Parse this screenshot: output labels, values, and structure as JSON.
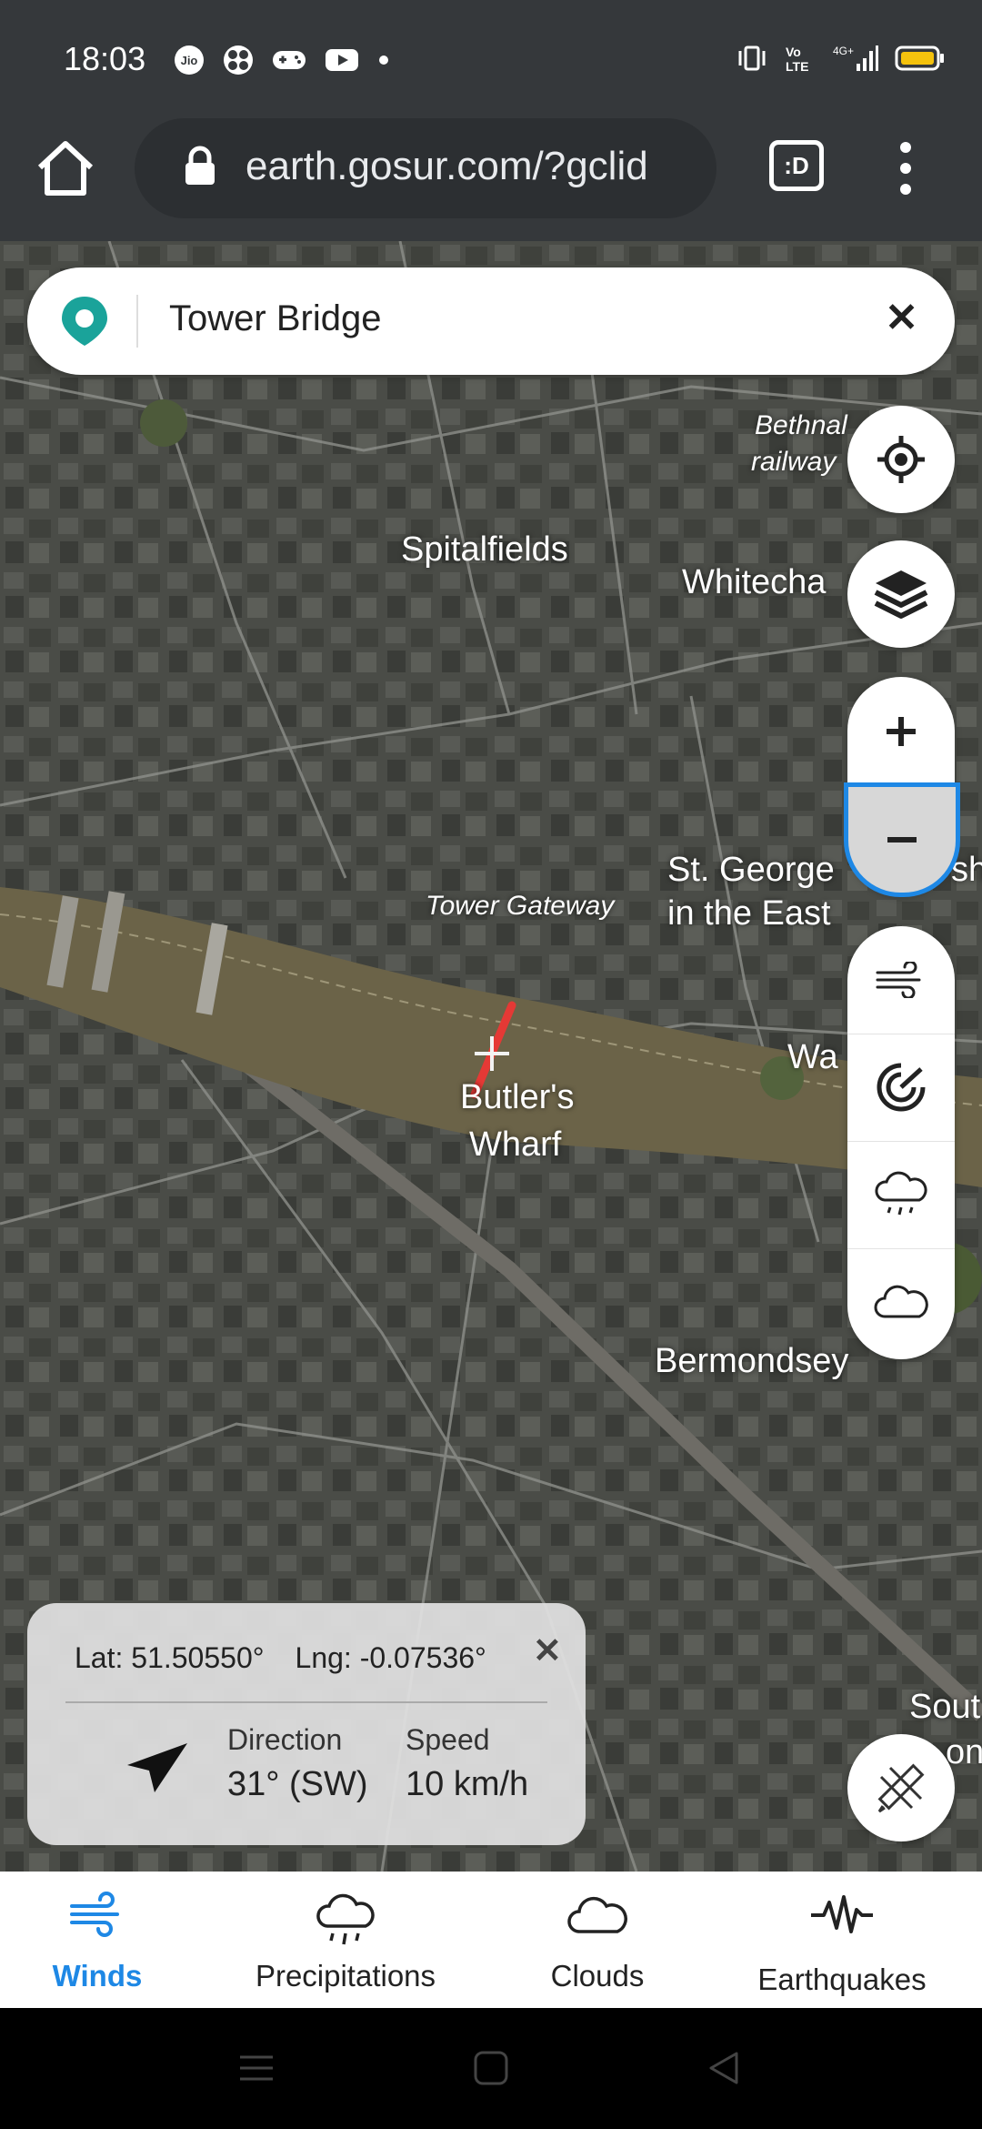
{
  "status_bar": {
    "time": "18:03"
  },
  "browser": {
    "url": "earth.gosur.com/?gclid",
    "tabs_label": ":D"
  },
  "search": {
    "value": "Tower Bridge"
  },
  "map_labels": {
    "spitalfields": "Spitalfields",
    "whitechapel": "Whitecha",
    "bethnal": "Bethnal",
    "railway": "railway",
    "tower_gateway": "Tower Gateway",
    "st_george": "St. George",
    "st_george_sh": "sh",
    "in_the_east": "in the East",
    "butlers": "Butler's",
    "wharf": "Wharf",
    "wa": "Wa",
    "bermondsey": "Bermondsey",
    "south": "Sout",
    "on": "on"
  },
  "info_panel": {
    "lat": "Lat: 51.50550°",
    "lng": "Lng: -0.07536°",
    "direction_label": "Direction",
    "direction_value": "31° (SW)",
    "speed_label": "Speed",
    "speed_value": "10 km/h"
  },
  "bottom_nav": {
    "winds": "Winds",
    "precipitations": "Precipitations",
    "clouds": "Clouds",
    "earthquakes": "Earthquakes"
  },
  "colors": {
    "accent": "#1e88e5",
    "logo": "#1aa39a",
    "route": "#e53935"
  }
}
